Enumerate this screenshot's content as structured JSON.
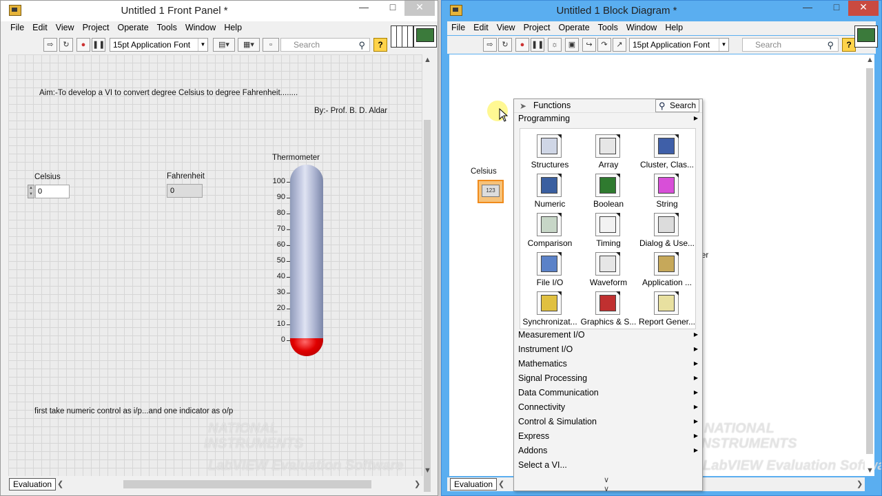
{
  "front_panel": {
    "title": "Untitled 1 Front Panel *",
    "menu": [
      "File",
      "Edit",
      "View",
      "Project",
      "Operate",
      "Tools",
      "Window",
      "Help"
    ],
    "font_selector": "15pt Application Font",
    "search_placeholder": "Search",
    "aim_text": "Aim:-To develop a VI to convert degree Celsius to degree Fahrenheit........",
    "author_text": "By:- Prof. B. D. Aldar",
    "celsius": {
      "label": "Celsius",
      "value": "0"
    },
    "fahrenheit": {
      "label": "Fahrenheit",
      "value": "0"
    },
    "thermometer": {
      "label": "Thermometer",
      "ticks": [
        "100",
        "90",
        "80",
        "70",
        "60",
        "50",
        "40",
        "30",
        "20",
        "10",
        "0"
      ],
      "level_percent": 0
    },
    "note_text": "first take numeric control as i/p...and one indicator as o/p",
    "status_tab": "Evaluation"
  },
  "block_diagram": {
    "title": "Untitled 1 Block Diagram *",
    "menu": [
      "File",
      "Edit",
      "View",
      "Project",
      "Operate",
      "Tools",
      "Window",
      "Help"
    ],
    "font_selector": "15pt Application Font",
    "search_placeholder": "Search",
    "terminal_label": "Celsius",
    "terminal_value": "123",
    "partial_label": "er",
    "status_tab": "Evaluation"
  },
  "functions_palette": {
    "title": "Functions",
    "search_label": "Search",
    "top_category": "Programming",
    "tiles": [
      {
        "label": "Structures",
        "icon": "structures-icon"
      },
      {
        "label": "Array",
        "icon": "array-icon"
      },
      {
        "label": "Cluster, Clas...",
        "icon": "cluster-icon"
      },
      {
        "label": "Numeric",
        "icon": "numeric-icon"
      },
      {
        "label": "Boolean",
        "icon": "boolean-icon"
      },
      {
        "label": "String",
        "icon": "string-icon"
      },
      {
        "label": "Comparison",
        "icon": "comparison-icon"
      },
      {
        "label": "Timing",
        "icon": "timing-icon"
      },
      {
        "label": "Dialog & Use...",
        "icon": "dialog-icon"
      },
      {
        "label": "File I/O",
        "icon": "file-io-icon"
      },
      {
        "label": "Waveform",
        "icon": "waveform-icon"
      },
      {
        "label": "Application ...",
        "icon": "application-control-icon"
      },
      {
        "label": "Synchronizat...",
        "icon": "synchronization-icon"
      },
      {
        "label": "Graphics & S...",
        "icon": "graphics-sound-icon"
      },
      {
        "label": "Report Gener...",
        "icon": "report-generation-icon"
      }
    ],
    "categories": [
      "Measurement I/O",
      "Instrument I/O",
      "Mathematics",
      "Signal Processing",
      "Data Communication",
      "Connectivity",
      "Control & Simulation",
      "Express",
      "Addons",
      "Select a VI..."
    ]
  },
  "watermark": {
    "line1": "NATIONAL",
    "line2": "INSTRUMENTS",
    "line3": "LabVIEW Evaluation Software"
  },
  "colors": {
    "accent_titlebar": "#5aaef0",
    "bulb_red": "#e00000",
    "terminal_orange": "#f08a1a"
  }
}
